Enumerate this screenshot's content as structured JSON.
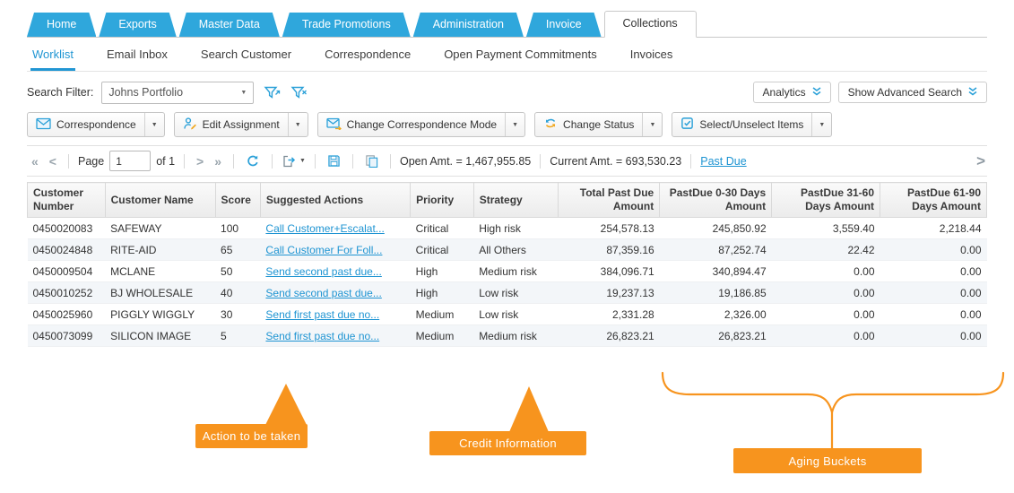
{
  "colors": {
    "tab_blue": "#2fa7dc",
    "link_blue": "#1e94d2",
    "annotation_orange": "#f7941e"
  },
  "main_tabs": [
    "Home",
    "Exports",
    "Master Data",
    "Trade Promotions",
    "Administration",
    "Invoice",
    "Collections"
  ],
  "active_main_tab": "Collections",
  "sub_tabs": [
    "Worklist",
    "Email Inbox",
    "Search Customer",
    "Correspondence",
    "Open Payment Commitments",
    "Invoices"
  ],
  "active_sub_tab": "Worklist",
  "filter_bar": {
    "label": "Search Filter:",
    "selected_filter": "Johns Portfolio",
    "analytics_button": "Analytics",
    "advanced_search_button": "Show Advanced Search"
  },
  "toolbar": {
    "correspondence": "Correspondence",
    "edit_assignment": "Edit Assignment",
    "change_correspondence_mode": "Change Correspondence Mode",
    "change_status": "Change Status",
    "select_unselect_items": "Select/Unselect Items"
  },
  "pagination": {
    "page_label": "Page",
    "page_value": "1",
    "pages_total_label": "of 1",
    "open_amount_label": "Open Amt. = 1,467,955.85",
    "current_amount_label": "Current Amt. = 693,530.23",
    "past_due_link": "Past Due"
  },
  "icons": {
    "caret_down": "▼",
    "first_page": "«",
    "prev_page": "<",
    "next_page": ">",
    "last_page": "»",
    "scroll_columns_right": ">"
  },
  "table": {
    "columns": [
      "Customer Number",
      "Customer Name",
      "Score",
      "Suggested Actions",
      "Priority",
      "Strategy",
      "Total Past Due Amount",
      "PastDue 0-30 Days Amount",
      "PastDue 31-60 Days Amount",
      "PastDue 61-90 Days Amount"
    ],
    "rows": [
      {
        "customer_number": "0450020083",
        "customer_name": "SAFEWAY",
        "score": "100",
        "suggested_action": "Call Customer+Escalat...",
        "priority": "Critical",
        "strategy": "High risk",
        "total_past_due": "254,578.13",
        "pastdue_0_30": "245,850.92",
        "pastdue_31_60": "3,559.40",
        "pastdue_61_90": "2,218.44"
      },
      {
        "customer_number": "0450024848",
        "customer_name": "RITE-AID",
        "score": "65",
        "suggested_action": "Call Customer For Foll...",
        "priority": "Critical",
        "strategy": "All Others",
        "total_past_due": "87,359.16",
        "pastdue_0_30": "87,252.74",
        "pastdue_31_60": "22.42",
        "pastdue_61_90": "0.00"
      },
      {
        "customer_number": "0450009504",
        "customer_name": "MCLANE",
        "score": "50",
        "suggested_action": "Send second past due...",
        "priority": "High",
        "strategy": "Medium risk",
        "total_past_due": "384,096.71",
        "pastdue_0_30": "340,894.47",
        "pastdue_31_60": "0.00",
        "pastdue_61_90": "0.00"
      },
      {
        "customer_number": "0450010252",
        "customer_name": "BJ WHOLESALE",
        "score": "40",
        "suggested_action": "Send second past due...",
        "priority": "High",
        "strategy": "Low risk",
        "total_past_due": "19,237.13",
        "pastdue_0_30": "19,186.85",
        "pastdue_31_60": "0.00",
        "pastdue_61_90": "0.00"
      },
      {
        "customer_number": "0450025960",
        "customer_name": "PIGGLY WIGGLY",
        "score": "30",
        "suggested_action": "Send first past due no...",
        "priority": "Medium",
        "strategy": "Low risk",
        "total_past_due": "2,331.28",
        "pastdue_0_30": "2,326.00",
        "pastdue_31_60": "0.00",
        "pastdue_61_90": "0.00"
      },
      {
        "customer_number": "0450073099",
        "customer_name": "SILICON IMAGE",
        "score": "5",
        "suggested_action": "Send first past due no...",
        "priority": "Medium",
        "strategy": "Medium risk",
        "total_past_due": "26,823.21",
        "pastdue_0_30": "26,823.21",
        "pastdue_31_60": "0.00",
        "pastdue_61_90": "0.00"
      }
    ]
  },
  "annotations": {
    "suggested_actions": "Action to be taken",
    "strategy": "Credit Information",
    "aging_buckets": "Aging Buckets"
  }
}
